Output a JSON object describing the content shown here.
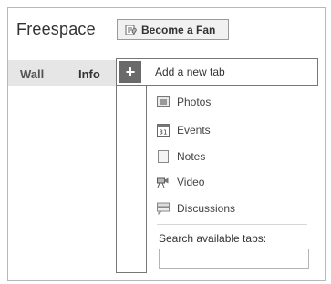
{
  "page": {
    "title": "Freespace"
  },
  "fan_button": {
    "label": "Become a Fan",
    "icon": "fan-icon"
  },
  "tabs": [
    {
      "label": "Wall"
    },
    {
      "label": "Info"
    }
  ],
  "add_tab": {
    "label": "Add a new tab",
    "icon": "plus-icon"
  },
  "menu_items": [
    {
      "label": "Photos",
      "icon": "photos-icon"
    },
    {
      "label": "Events",
      "icon": "events-icon",
      "icon_text": "31"
    },
    {
      "label": "Notes",
      "icon": "notes-icon"
    },
    {
      "label": "Video",
      "icon": "video-icon"
    },
    {
      "label": "Discussions",
      "icon": "discussions-icon"
    }
  ],
  "search": {
    "label": "Search available tabs:",
    "value": ""
  }
}
